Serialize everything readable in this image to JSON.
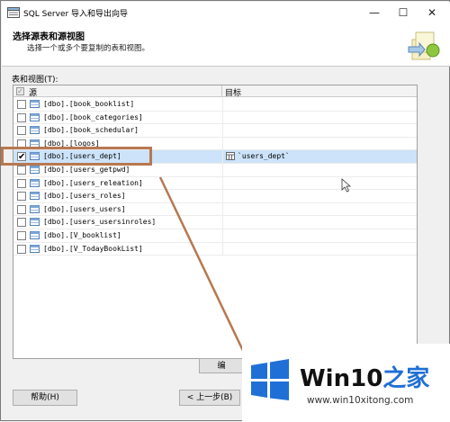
{
  "window": {
    "title": "SQL Server 导入和导出向导",
    "minimize_icon": "minimize-icon",
    "maximize_icon": "maximize-icon",
    "close_icon": "close-icon"
  },
  "header": {
    "title": "选择源表和源视图",
    "description": "选择一个或多个要复制的表和视图。"
  },
  "list_label": "表和视图(T):",
  "grid": {
    "columns": {
      "source": "源",
      "destination": "目标"
    },
    "rows": [
      {
        "label": "[dbo].[book_booklist]",
        "checked": false,
        "destination": ""
      },
      {
        "label": "[dbo].[book_categories]",
        "checked": false,
        "destination": ""
      },
      {
        "label": "[dbo].[book_schedular]",
        "checked": false,
        "destination": ""
      },
      {
        "label": "[dbo].[logos]",
        "checked": false,
        "destination": ""
      },
      {
        "label": "[dbo].[users_dept]",
        "checked": true,
        "destination": "`users_dept`"
      },
      {
        "label": "[dbo].[users_getpwd]",
        "checked": false,
        "destination": ""
      },
      {
        "label": "[dbo].[users_releation]",
        "checked": false,
        "destination": ""
      },
      {
        "label": "[dbo].[users_roles]",
        "checked": false,
        "destination": ""
      },
      {
        "label": "[dbo].[users_users]",
        "checked": false,
        "destination": ""
      },
      {
        "label": "[dbo].[users_usersinroles]",
        "checked": false,
        "destination": ""
      },
      {
        "label": "[dbo].[V_booklist]",
        "checked": false,
        "destination": ""
      },
      {
        "label": "[dbo].[V_TodayBookList]",
        "checked": false,
        "destination": ""
      }
    ]
  },
  "buttons": {
    "partial": "编",
    "help": "帮助(H)",
    "back": "< 上一步(B)"
  },
  "watermark": {
    "brand": "Win10",
    "brand_suffix": "之家",
    "url": "www.win10xitong.com"
  },
  "colors": {
    "highlight_border": "#b87850",
    "selected_row": "#cce3f9",
    "windows_blue": "#1f6fd6"
  }
}
